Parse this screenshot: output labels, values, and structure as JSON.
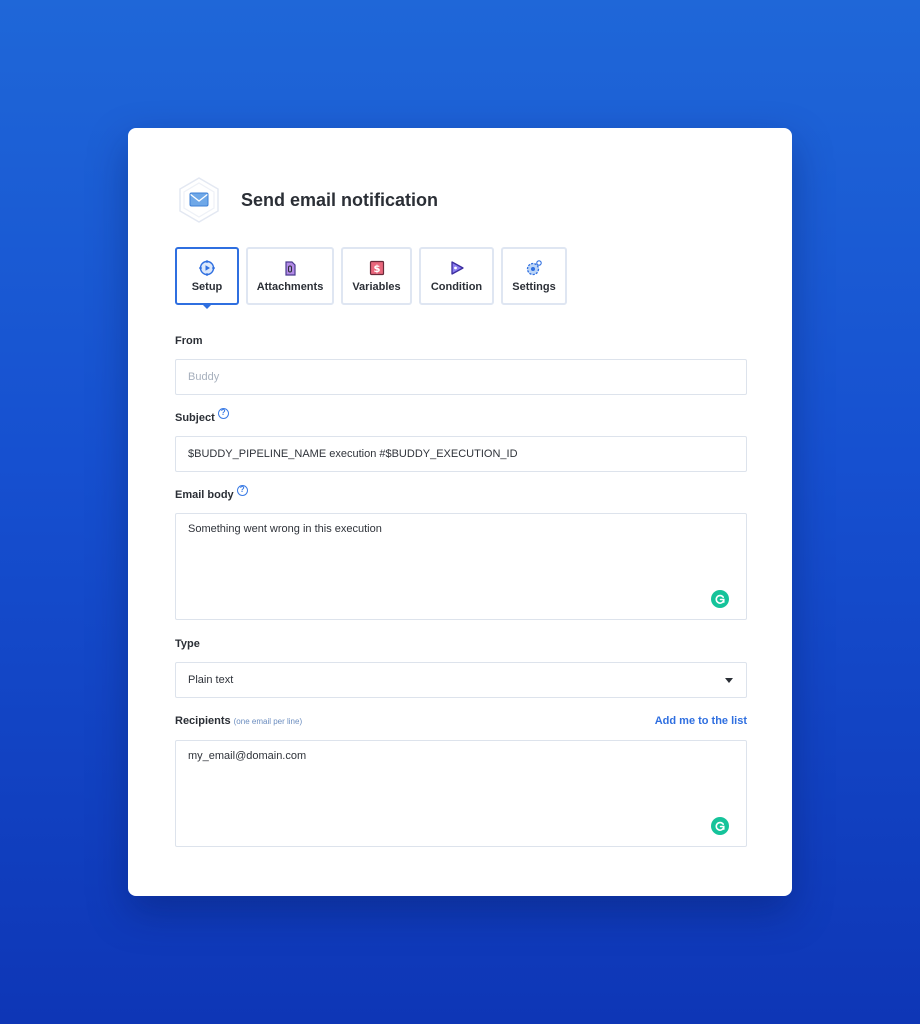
{
  "header": {
    "title": "Send email notification",
    "icon": "email-envelope-icon"
  },
  "tabs": [
    {
      "label": "Setup",
      "icon": "setup-icon",
      "active": true
    },
    {
      "label": "Attachments",
      "icon": "attachments-icon",
      "active": false
    },
    {
      "label": "Variables",
      "icon": "variables-icon",
      "active": false
    },
    {
      "label": "Condition",
      "icon": "condition-icon",
      "active": false
    },
    {
      "label": "Settings",
      "icon": "settings-icon",
      "active": false
    }
  ],
  "form": {
    "from": {
      "label": "From",
      "placeholder": "Buddy",
      "value": ""
    },
    "subject": {
      "label": "Subject",
      "help": "?",
      "value": "$BUDDY_PIPELINE_NAME execution #$BUDDY_EXECUTION_ID"
    },
    "email_body": {
      "label": "Email body",
      "help": "?",
      "value": "Something went wrong in this execution"
    },
    "type": {
      "label": "Type",
      "value": "Plain text"
    },
    "recipients": {
      "label": "Recipients",
      "hint": "(one email per line)",
      "add_link": "Add me to the list",
      "value": "my_email@domain.com"
    }
  },
  "colors": {
    "accent": "#2f6fe0",
    "grammarly": "#15c39a",
    "background_top": "#1f67d8",
    "background_bottom": "#0e36b6"
  }
}
